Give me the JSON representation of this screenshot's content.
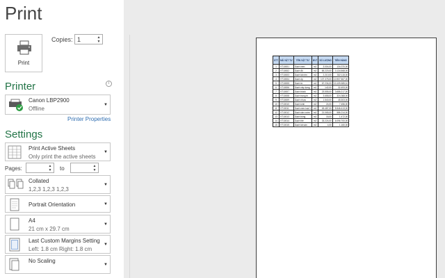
{
  "title": "Print",
  "print_button": {
    "label": "Print"
  },
  "copies": {
    "label": "Copies:",
    "value": "1"
  },
  "printer": {
    "heading": "Printer",
    "name": "Canon LBP2900",
    "status": "Offline",
    "properties_link": "Printer Properties"
  },
  "settings": {
    "heading": "Settings",
    "print_what": {
      "title": "Print Active Sheets",
      "subtitle": "Only print the active sheets"
    },
    "pages": {
      "label": "Pages:",
      "to_label": "to",
      "from": "",
      "to": ""
    },
    "collation": {
      "title": "Collated",
      "subtitle": "1,2,3    1,2,3    1,2,3"
    },
    "orientation": {
      "title": "Portrait Orientation"
    },
    "paper": {
      "title": "A4",
      "subtitle": "21 cm x 29.7 cm"
    },
    "margins": {
      "title": "Last Custom Margins Setting",
      "subtitle": "Left:  1.8 cm    Right:  1.8 cm"
    },
    "scaling": {
      "title": "No Scaling"
    }
  },
  "preview": {
    "headers": [
      "STT",
      "MÃ VẬT TƯ",
      "TÊN VẬT TƯ",
      "ĐVT",
      "SỐ LƯỢNG",
      "TIỀN HÀNG"
    ],
    "rows": [
      [
        "1",
        "VT10001",
        "Gạch men",
        "m2",
        "3.004,00",
        "134.370,00"
      ],
      [
        "2",
        "VT10002",
        "Gạch đỏ",
        "m2",
        "65.220,00",
        "3.134.568,00"
      ],
      [
        "3",
        "VT10003",
        "Gạch lát nền",
        "m2",
        "2.210,00",
        "332.115,00"
      ],
      [
        "4",
        "VT10004",
        "Gạch ốp",
        "m2",
        "107.375,00",
        "10.907.567,00"
      ],
      [
        "5",
        "VT10005",
        "Gạch lá",
        "m2",
        "67.234,00",
        "10.109.385,10"
      ],
      [
        "6",
        "VT10006",
        "Gạch xây dựng",
        "m2",
        "142,00",
        "32.493,00"
      ],
      [
        "7",
        "VT10007",
        "Gạch block",
        "m2",
        "23.555,00",
        "3.686.217,00"
      ],
      [
        "8",
        "VT10008",
        "Gạch trang trí",
        "m2",
        "3.658,00",
        "324.368,00"
      ],
      [
        "9",
        "VT10009",
        "Gạch nhựa",
        "m2",
        "1.540,00",
        "45.303,00"
      ],
      [
        "10",
        "VT10010",
        "Gạch kính",
        "m2",
        "24,00",
        "7.456,00"
      ],
      [
        "11",
        "VT10011",
        "Gạch men loại 1",
        "m2",
        "45.487,00",
        "5.546.413,00"
      ],
      [
        "12",
        "VT10012",
        "Gạch sân vườn",
        "m2",
        "21.065,00",
        "586.214,00"
      ],
      [
        "13",
        "VT10013",
        "Gạch bông",
        "m2",
        "16,00",
        "1.472,00"
      ],
      [
        "14",
        "VT10014",
        "Gạch thẻ",
        "m2",
        "33.224,00",
        "6.096.700,00"
      ],
      [
        "15",
        "VT10015",
        "Gạch lát sân",
        "m2",
        "4,00",
        "1.160,00"
      ]
    ]
  }
}
